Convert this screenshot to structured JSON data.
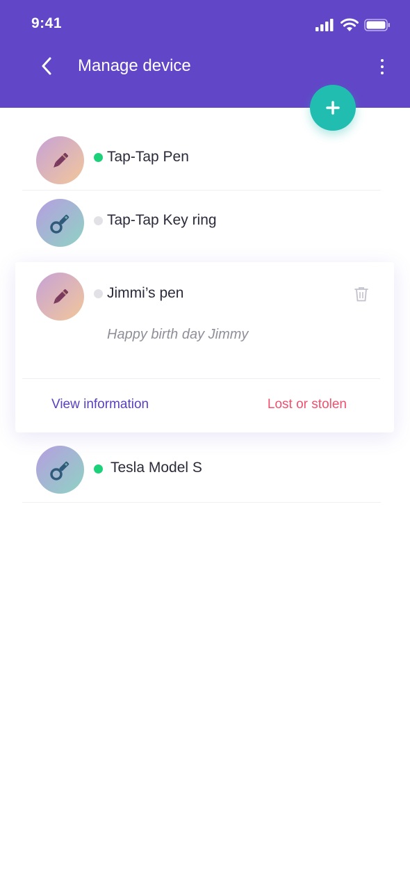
{
  "status_bar": {
    "time": "9:41"
  },
  "header": {
    "title": "Manage device"
  },
  "devices": [
    {
      "name": "Tap-Tap Pen",
      "online": true,
      "type": "pen"
    },
    {
      "name": "Tap-Tap Key ring",
      "online": false,
      "type": "key"
    },
    {
      "name": "Jimmi’s pen",
      "online": false,
      "type": "pen",
      "note": "Happy birth day Jimmy",
      "expanded": true
    },
    {
      "name": "Tesla Model S",
      "online": true,
      "type": "key"
    }
  ],
  "card_actions": {
    "view_info": "View information",
    "lost_stolen": "Lost or stolen"
  },
  "colors": {
    "primary": "#6246c8",
    "fab": "#22bdb1",
    "online": "#1dd17a",
    "danger": "#f0506e"
  },
  "icons": [
    "back-arrow-icon",
    "more-vert-icon",
    "plus-icon",
    "pen-icon",
    "key-icon",
    "trash-icon",
    "signal-icon",
    "wifi-icon",
    "battery-icon"
  ]
}
